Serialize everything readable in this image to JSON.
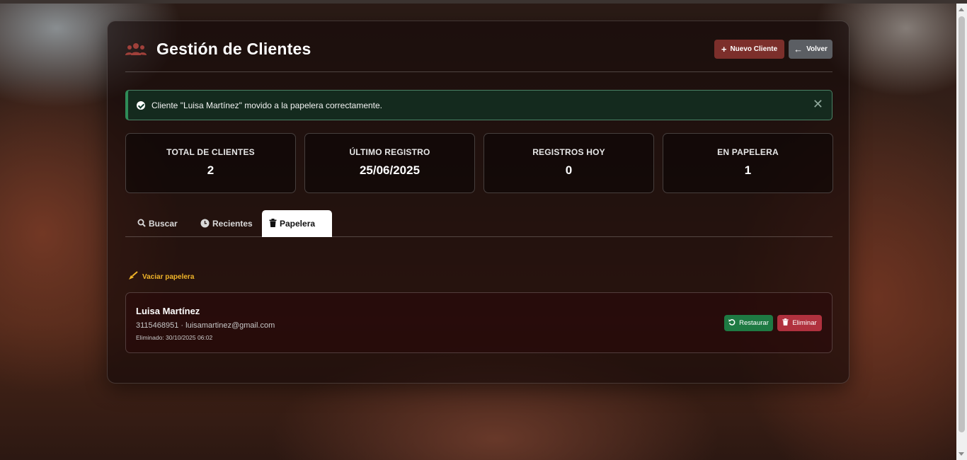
{
  "header": {
    "title": "Gestión de Clientes",
    "new_client_label": "Nuevo Cliente",
    "back_label": "Volver"
  },
  "alert": {
    "message": "Cliente \"Luisa Martínez\" movido a la papelera correctamente.",
    "close_symbol": "✕"
  },
  "stats": [
    {
      "label": "TOTAL DE CLIENTES",
      "value": "2"
    },
    {
      "label": "ÚLTIMO REGISTRO",
      "value": "25/06/2025"
    },
    {
      "label": "REGISTROS HOY",
      "value": "0"
    },
    {
      "label": "EN PAPELERA",
      "value": "1"
    }
  ],
  "tabs": [
    {
      "label": "Buscar",
      "icon": "search-icon",
      "active": false
    },
    {
      "label": "Recientes",
      "icon": "clock-icon",
      "active": false
    },
    {
      "label": "Papelera",
      "icon": "trash-icon",
      "active": true
    }
  ],
  "trash": {
    "empty_label": "Vaciar papelera",
    "items": [
      {
        "name": "Luisa Martínez",
        "contact": "3115468951 · luisamartinez@gmail.com",
        "deleted": "Eliminado: 30/10/2025 06:02",
        "restore_label": "Restaurar",
        "delete_label": "Eliminar"
      }
    ]
  },
  "colors": {
    "primary": "#7c2f2b",
    "secondary": "#5b5e63",
    "success": "#1e7a43",
    "danger": "#b0313e",
    "warning": "#f0b429"
  }
}
